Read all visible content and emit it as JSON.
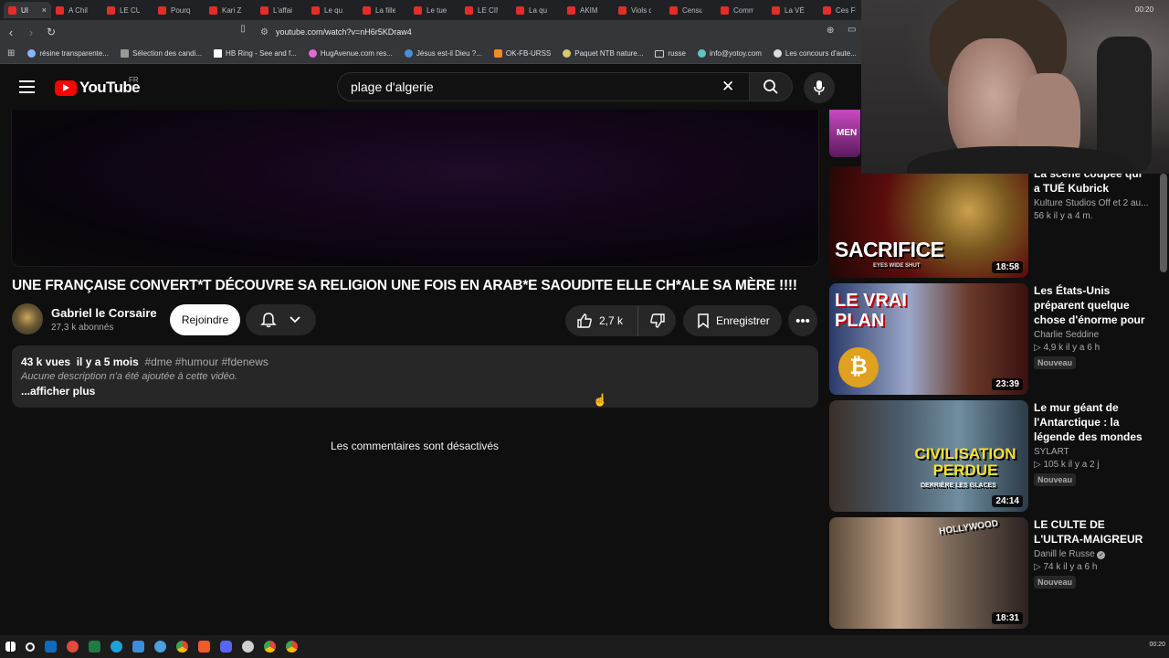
{
  "browser": {
    "tabs": [
      {
        "label": "UI",
        "active": true
      },
      {
        "label": "A Chil"
      },
      {
        "label": "LE CU"
      },
      {
        "label": "Pourq"
      },
      {
        "label": "Kari Z"
      },
      {
        "label": "L'affai"
      },
      {
        "label": "Le qu"
      },
      {
        "label": "La fille"
      },
      {
        "label": "Le tue"
      },
      {
        "label": "LE CIN"
      },
      {
        "label": "La qu"
      },
      {
        "label": "AKIM"
      },
      {
        "label": "Viols d"
      },
      {
        "label": "Censu"
      },
      {
        "label": "Comm"
      },
      {
        "label": "La VÉ"
      },
      {
        "label": "Ces Fi"
      }
    ],
    "tab_close": "×",
    "url": "youtube.com/watch?v=nH6r5KDraw4",
    "bookmarks": [
      "résine transparente...",
      "Sélection des candi...",
      "HB Ring - See and f...",
      "HugAvenue.com res...",
      "Jésus est-il Dieu ?...",
      "OK-FB-URSS",
      "Paquet NTB nature...",
      "russe",
      "info@yotoy.com",
      "Les concours d'aute..."
    ]
  },
  "youtube": {
    "logo_text": "YouTube",
    "region": "FR",
    "search_value": "plage d'algerie"
  },
  "video": {
    "title": "UNE FRANÇAISE CONVERT*T DÉCOUVRE SA RELIGION UNE FOIS EN ARAB*E SAOUDITE ELLE CH*ALE SA MÈRE !!!!",
    "channel": "Gabriel le Corsaire",
    "subscribers": "27,3 k abonnés",
    "join_label": "Rejoindre",
    "likes": "2,7 k",
    "save_label": "Enregistrer",
    "views": "43 k vues",
    "age": "il y a 5 mois",
    "tags": "#dme #humour #fdenews",
    "description": "Aucune description n'a été ajoutée à cette vidéo.",
    "show_more": "...afficher plus",
    "comments_notice": "Les commentaires sont désactivés"
  },
  "recommendations": [
    {
      "title": "La scène coupée qui a TUÉ Kubrick",
      "channel": "Kulture Studios Off et 2 au...",
      "stats": "56 k  il y a 4 m.",
      "duration": "18:58",
      "thumb_text": "SACRIFICE",
      "thumb_sub": "EYES WIDE SHUT",
      "badge": ""
    },
    {
      "title": "Les États-Unis préparent quelque chose d'énorme pour ...",
      "channel": "Charlie Seddine",
      "stats": "▷ 4,9 k  il y a 6 h",
      "duration": "23:39",
      "thumb_text": "LE VRAI PLAN",
      "badge": "Nouveau"
    },
    {
      "title": "Le mur géant de l'Antarctique : la légende des mondes ...",
      "channel": "SYLART",
      "stats": "▷ 105 k  il y a 2 j",
      "duration": "24:14",
      "thumb_text": "CIVILISATION PERDUE",
      "thumb_sub": "DERRIÈRE LES GLACES",
      "badge": "Nouveau"
    },
    {
      "title": "LE CULTE DE L'ULTRA-MAIGREUR",
      "channel": "Danill le Russe",
      "stats": "▷ 74 k  il y a 6 h",
      "duration": "18:31",
      "thumb_text": "HOLLYWOOD",
      "badge": "Nouveau"
    }
  ],
  "partial_thumb_text": "MEN",
  "webcam_clock": "00:20",
  "taskbar_clock": "00:20"
}
